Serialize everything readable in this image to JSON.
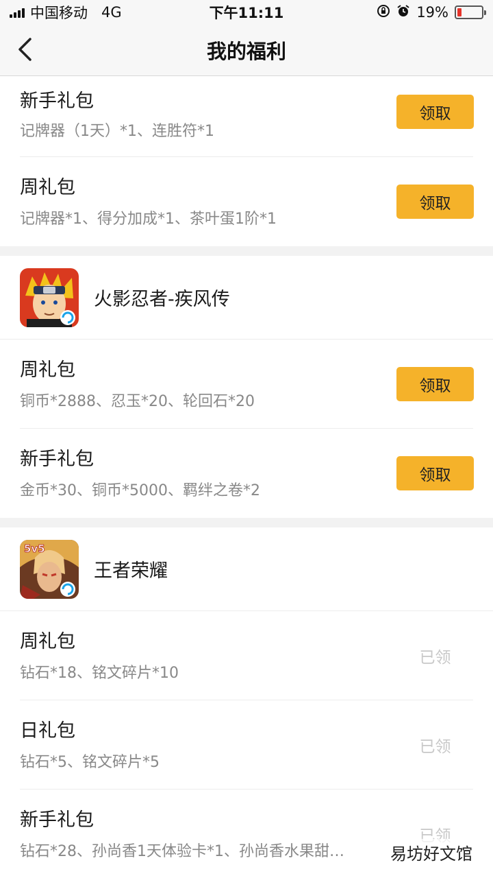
{
  "status_bar": {
    "carrier": "中国移动",
    "network": "4G",
    "time": "下午11:11",
    "battery_percent": "19%",
    "battery_level": 0.19
  },
  "nav": {
    "title": "我的福利",
    "back_icon": "chevron-left-icon"
  },
  "groups": [
    {
      "game_name": "",
      "items": [
        {
          "name": "新手礼包",
          "desc": "记牌器（1天）*1、连胜符*1",
          "action": "领取",
          "claimed": false
        },
        {
          "name": "周礼包",
          "desc": "记牌器*1、得分加成*1、茶叶蛋1阶*1",
          "action": "领取",
          "claimed": false
        }
      ]
    },
    {
      "game_name": "火影忍者-疾风传",
      "items": [
        {
          "name": "周礼包",
          "desc": "铜币*2888、忍玉*20、轮回石*20",
          "action": "领取",
          "claimed": false
        },
        {
          "name": "新手礼包",
          "desc": "金币*30、铜币*5000、羁绊之卷*2",
          "action": "领取",
          "claimed": false
        }
      ]
    },
    {
      "game_name": "王者荣耀",
      "items": [
        {
          "name": "周礼包",
          "desc": "钻石*18、铭文碎片*10",
          "action": "已领",
          "claimed": true
        },
        {
          "name": "日礼包",
          "desc": "钻石*5、铭文碎片*5",
          "action": "已领",
          "claimed": true
        },
        {
          "name": "新手礼包",
          "desc": "钻石*28、孙尚香1天体验卡*1、孙尚香水果甜…",
          "action": "已领",
          "claimed": true
        }
      ]
    }
  ],
  "watermark": "易坊好文馆",
  "colors": {
    "accent": "#f5b22a",
    "claimed_text": "#c8c8c8",
    "battery_low": "#e5332a"
  }
}
